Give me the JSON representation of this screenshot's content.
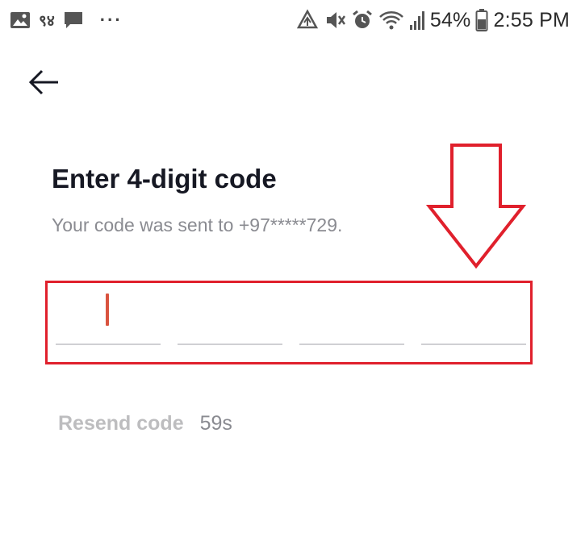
{
  "status_bar": {
    "left_icons": [
      "image-icon",
      "carrier-icon",
      "message-icon",
      "more-dots-icon"
    ],
    "carrier_text": "९४",
    "more_text": "···",
    "right_icons": [
      "data-saver-icon",
      "mute-icon",
      "alarm-icon",
      "wifi-icon",
      "signal-icon",
      "battery-icon"
    ],
    "battery": "54%",
    "time": "2:55 PM"
  },
  "header": {
    "back_icon": "back-arrow-icon"
  },
  "main": {
    "title": "Enter 4-digit code",
    "subtitle": "Your code was sent to +97*****729.",
    "code_inputs": [
      "",
      "",
      "",
      ""
    ],
    "active_input_index": 0,
    "resend_label": "Resend code",
    "resend_timer": "59s"
  },
  "annotation": {
    "color": "#e0202c"
  },
  "colors": {
    "title": "#161823",
    "subtitle": "#8a8b91",
    "caret": "#d9533f",
    "resend_disabled": "#bdbdbf",
    "underline": "#d0d0d3"
  }
}
